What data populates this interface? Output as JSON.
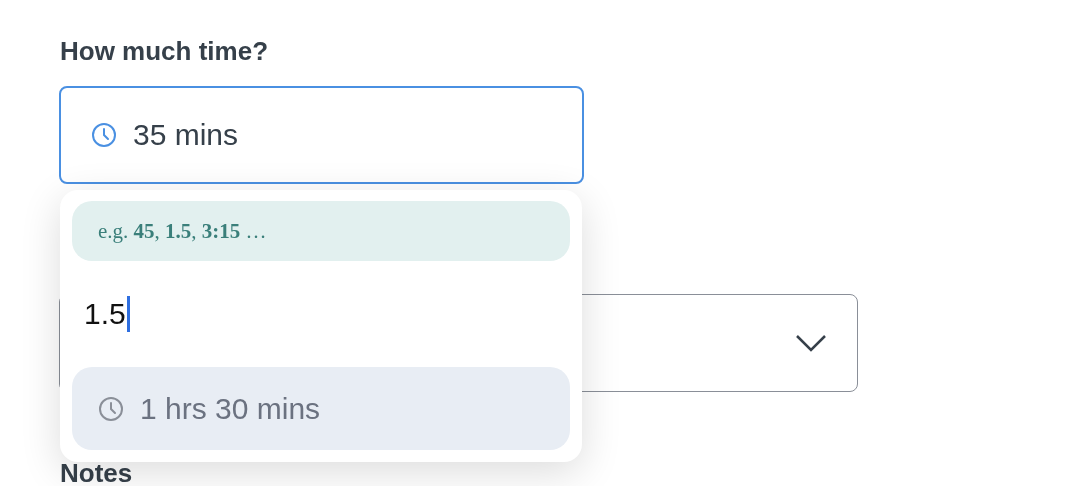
{
  "duration_field": {
    "label": "How much time?",
    "value": "35 mins",
    "focused": true
  },
  "select_field": {
    "expanded": false
  },
  "notes": {
    "label": "Notes"
  },
  "duration_popup": {
    "hint": "e.g. **45**, **1.5**, **3:15** …",
    "input": "1.5",
    "options": [
      {
        "label": "1 hrs 30 mins",
        "selected": false
      }
    ]
  }
}
